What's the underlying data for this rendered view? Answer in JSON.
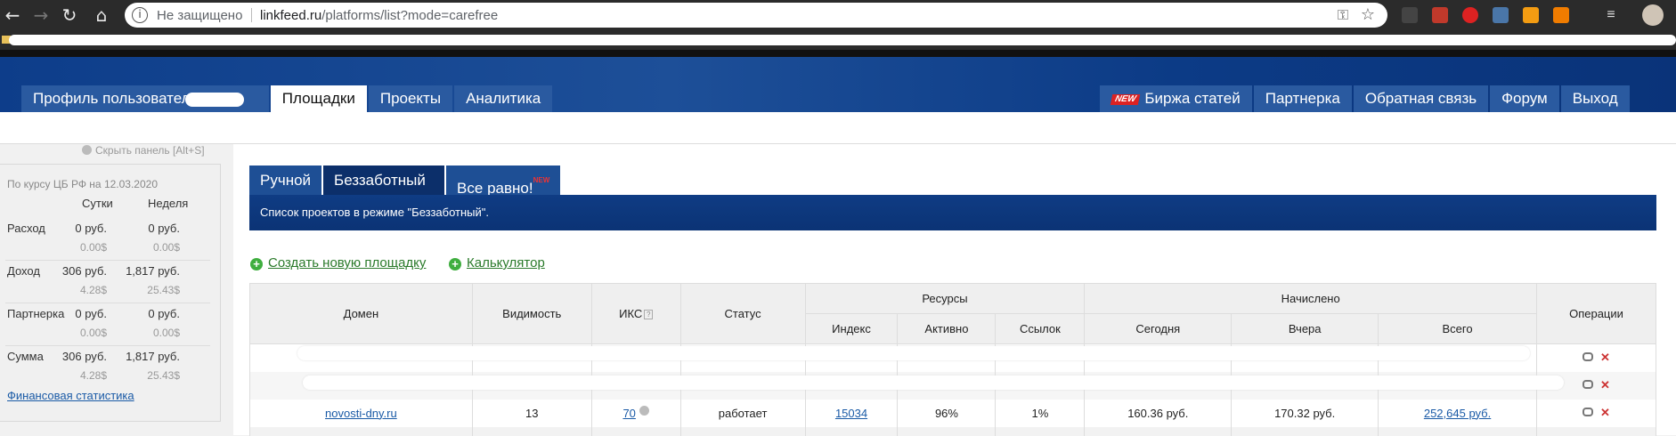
{
  "browser": {
    "security_label": "Не защищено",
    "url_host": "linkfeed.ru",
    "url_path": "/platforms/list?mode=carefree"
  },
  "nav": {
    "profile": "Профиль пользователя",
    "platforms": "Площадки",
    "projects": "Проекты",
    "analytics": "Аналитика",
    "new_badge": "NEW",
    "articles": "Биржа статей",
    "partner": "Партнерка",
    "feedback": "Обратная связь",
    "forum": "Форум",
    "logout": "Выход"
  },
  "sidebar": {
    "hide_panel": "Скрыть панель [Alt+S]",
    "rate_date": "По курсу ЦБ РФ на 12.03.2020",
    "col_day": "Сутки",
    "col_week": "Неделя",
    "rows": [
      {
        "label": "Расход",
        "day": "0 руб.",
        "day_usd": "0.00$",
        "week": "0 руб.",
        "week_usd": "0.00$"
      },
      {
        "label": "Доход",
        "day": "306 руб.",
        "day_usd": "4.28$",
        "week": "1,817 руб.",
        "week_usd": "25.43$"
      },
      {
        "label": "Партнерка",
        "day": "0 руб.",
        "day_usd": "0.00$",
        "week": "0 руб.",
        "week_usd": "0.00$"
      },
      {
        "label": "Сумма",
        "day": "306 руб.",
        "day_usd": "4.28$",
        "week": "1,817 руб.",
        "week_usd": "25.43$"
      }
    ],
    "fin_stats": "Финансовая статистика"
  },
  "tabs": {
    "manual": "Ручной",
    "carefree": "Беззаботный",
    "whatever": "Все равно!",
    "whatever_badge": "NEW"
  },
  "banner_text": "Список проектов в режиме \"Беззаботный\".",
  "actions": {
    "create": "Создать новую площадку",
    "calculator": "Калькулятор"
  },
  "table": {
    "h_domain": "Домен",
    "h_visibility": "Видимость",
    "h_iks": "ИКС",
    "h_status": "Статус",
    "h_resources": "Ресурсы",
    "h_accrued": "Начислено",
    "h_operations": "Операции",
    "h_index": "Индекс",
    "h_active": "Активно",
    "h_links": "Ссылок",
    "h_today": "Сегодня",
    "h_yesterday": "Вчера",
    "h_total": "Всего",
    "row3": {
      "domain": "novosti-dny.ru",
      "visibility": "13",
      "iks": "70",
      "status": "работает",
      "index": "15034",
      "active": "96%",
      "links": "1%",
      "today": "160.36 руб.",
      "yesterday": "170.32 руб.",
      "total": "252,645 руб."
    }
  }
}
